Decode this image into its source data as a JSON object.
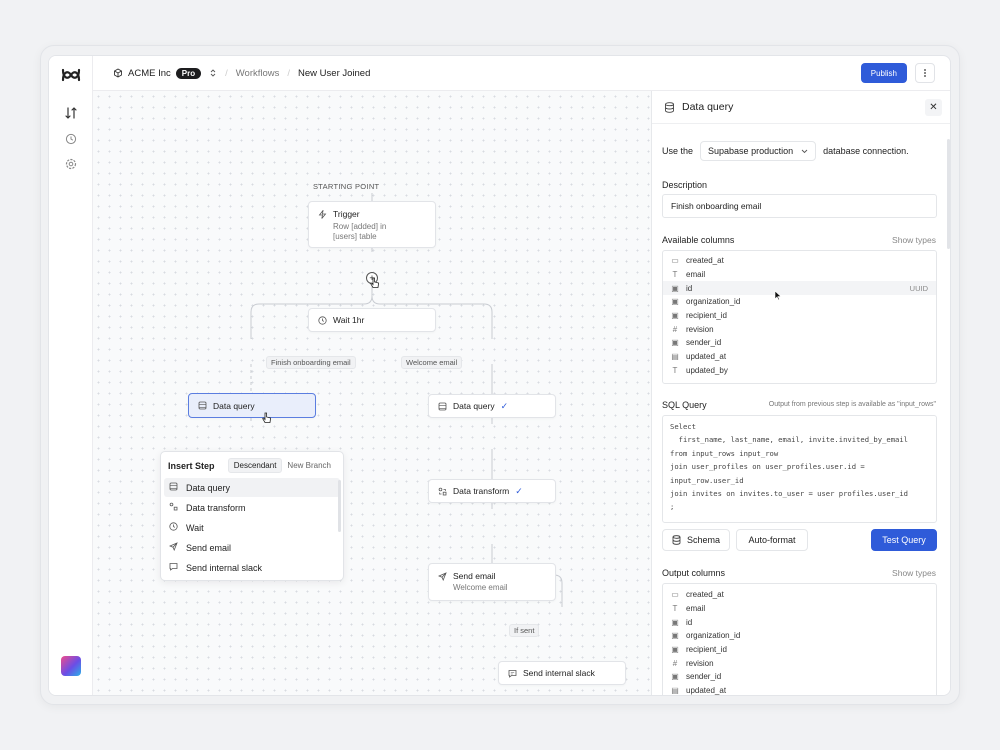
{
  "header": {
    "org_name": "ACME Inc",
    "plan_badge": "Pro",
    "breadcrumb_workflows": "Workflows",
    "breadcrumb_current": "New User Joined",
    "publish_label": "Publish"
  },
  "canvas": {
    "starting_point": "STARTING POINT",
    "trigger_title": "Trigger",
    "trigger_desc_1": "Row [added] in",
    "trigger_desc_2": "[users] table",
    "wait_label": "Wait 1hr",
    "branch_left": "Finish onboarding email",
    "branch_right": "Welcome email",
    "left_node": "Data query",
    "right_query": "Data query",
    "data_transform": "Data transform",
    "send_email_title": "Send email",
    "send_email_sub": "Welcome email",
    "if_sent": "If sent",
    "send_slack": "Send internal slack",
    "add_symbol": "+"
  },
  "insert_step": {
    "title": "Insert Step",
    "tab_descendant": "Descendant",
    "tab_new_branch": "New Branch",
    "items": [
      {
        "label": "Data query",
        "icon": "database-icon"
      },
      {
        "label": "Data transform",
        "icon": "transform-icon"
      },
      {
        "label": "Wait",
        "icon": "clock-icon"
      },
      {
        "label": "Send email",
        "icon": "send-icon"
      },
      {
        "label": "Send internal slack",
        "icon": "message-icon"
      }
    ]
  },
  "panel": {
    "title": "Data query",
    "use_the": "Use the",
    "connection": "Supabase production",
    "connection_suffix": "database connection.",
    "description_label": "Description",
    "description_value": "Finish onboarding email",
    "available_label": "Available columns",
    "show_types": "Show types",
    "available_columns": [
      {
        "name": "created_at",
        "icon": "calendar-icon"
      },
      {
        "name": "email",
        "icon": "text-icon"
      },
      {
        "name": "id",
        "icon": "key-icon",
        "type": "UUID"
      },
      {
        "name": "organization_id",
        "icon": "key-icon"
      },
      {
        "name": "recipient_id",
        "icon": "key-icon"
      },
      {
        "name": "revision",
        "icon": "hash-icon"
      },
      {
        "name": "sender_id",
        "icon": "key-icon"
      },
      {
        "name": "updated_at",
        "icon": "calendar-clock-icon"
      },
      {
        "name": "updated_by",
        "icon": "text-icon"
      }
    ],
    "sql_label": "SQL Query",
    "sql_hint": "Output from previous step is available as \"input_rows\"",
    "sql_lines": [
      "Select",
      "  first_name, last_name, email, invite.invited_by_email",
      "from input_rows input_row",
      "join user_profiles on user_profiles.user.id =",
      "input_row.user_id",
      "join invites on invites.to_user = user profiles.user_id",
      ";"
    ],
    "schema_btn": "Schema",
    "autoformat_btn": "Auto-format",
    "test_btn": "Test Query",
    "output_label": "Output columns",
    "output_show_types": "Show types",
    "output_columns": [
      {
        "name": "created_at",
        "icon": "calendar-icon"
      },
      {
        "name": "email",
        "icon": "text-icon"
      },
      {
        "name": "id",
        "icon": "key-icon"
      },
      {
        "name": "organization_id",
        "icon": "key-icon"
      },
      {
        "name": "recipient_id",
        "icon": "key-icon"
      },
      {
        "name": "revision",
        "icon": "hash-icon"
      },
      {
        "name": "sender_id",
        "icon": "key-icon"
      },
      {
        "name": "updated_at",
        "icon": "calendar-clock-icon"
      }
    ]
  },
  "colors": {
    "accent": "#2f5bd9",
    "selected_bg": "#e9eefb"
  }
}
